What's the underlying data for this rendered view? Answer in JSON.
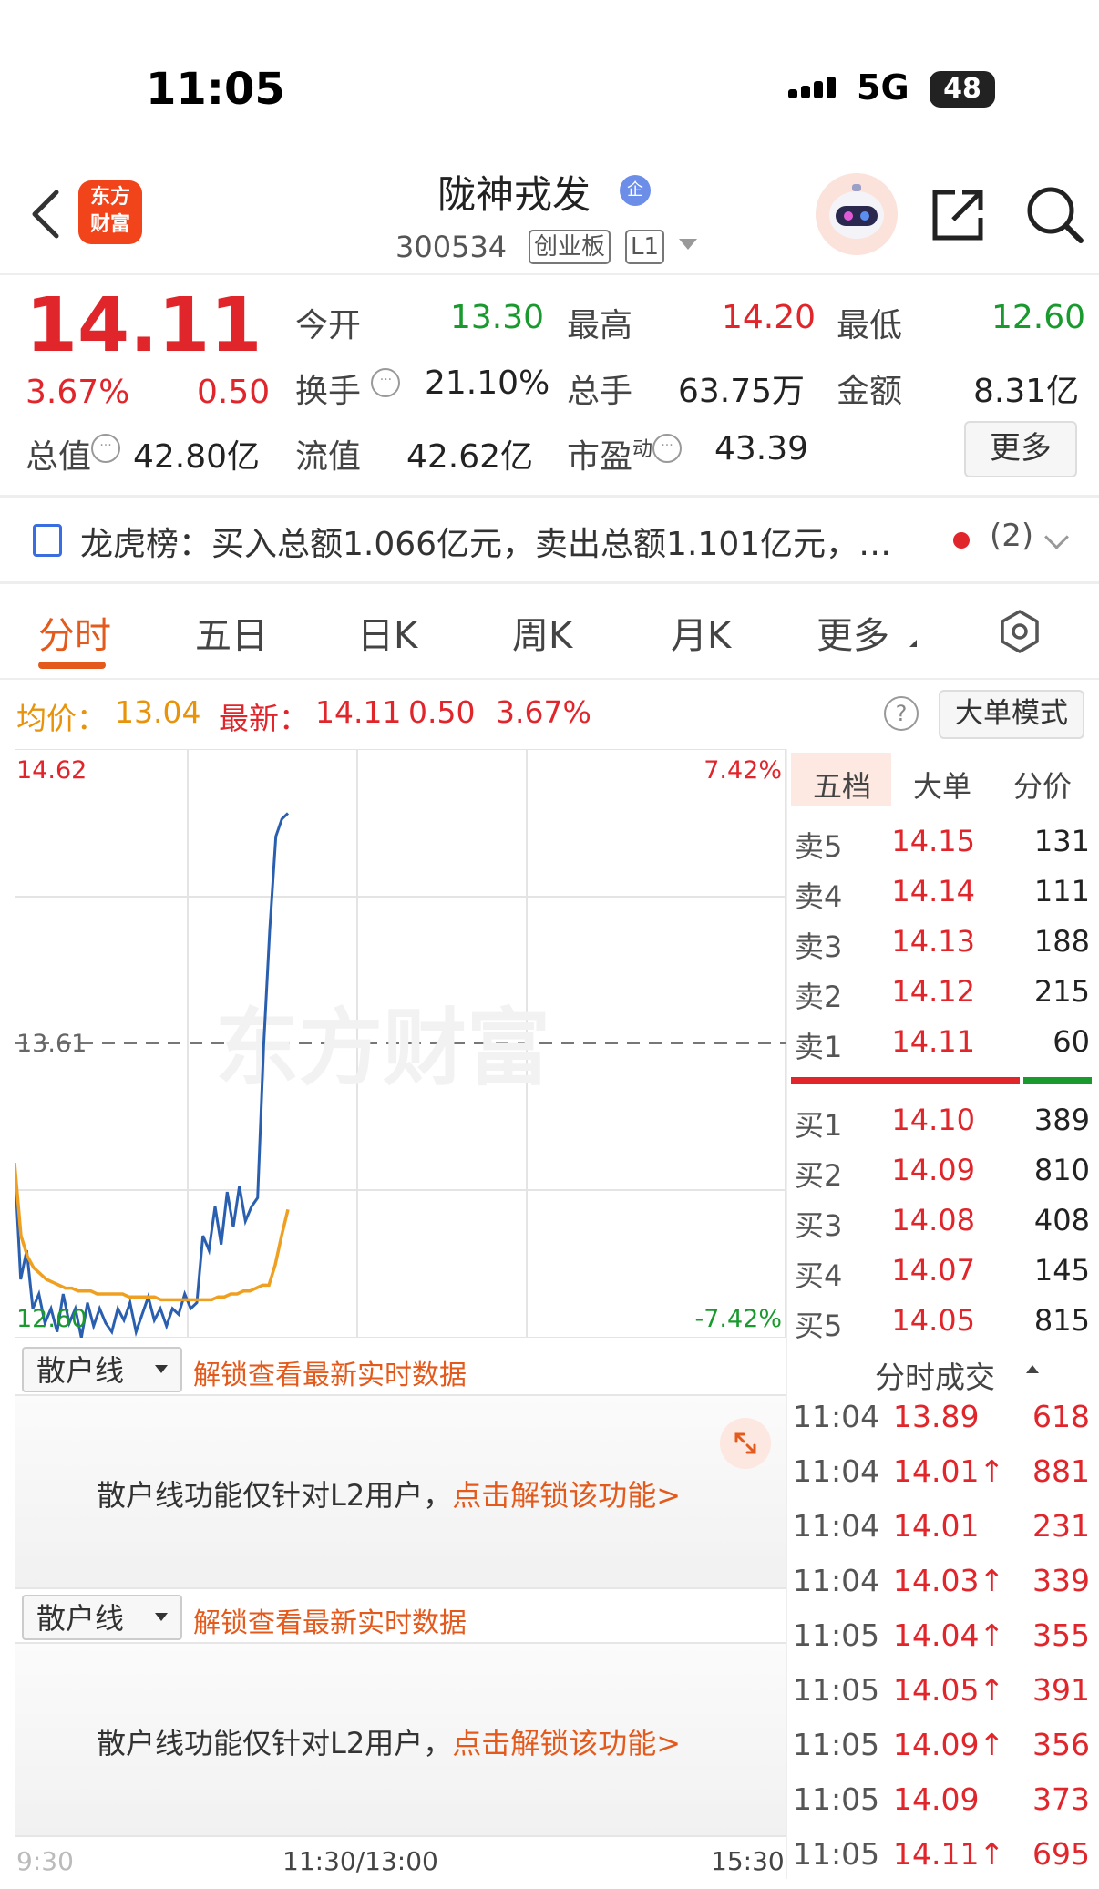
{
  "status_bar": {
    "time": "11:05",
    "network": "5G",
    "battery": "48"
  },
  "header": {
    "logo_line1": "东方",
    "logo_line2": "财富",
    "stock_name": "陇神戎发",
    "badge": "企",
    "code": "300534",
    "board": "创业板",
    "level": "L1"
  },
  "quote": {
    "price": "14.11",
    "change_pct": "3.67%",
    "change": "0.50",
    "open_label": "今开",
    "open": "13.30",
    "high_label": "最高",
    "high": "14.20",
    "low_label": "最低",
    "low": "12.60",
    "turnover_label": "换手",
    "turnover": "21.10%",
    "volume_label": "总手",
    "volume": "63.75万",
    "amount_label": "金额",
    "amount": "8.31亿",
    "mktcap_label": "总值",
    "mktcap": "42.80亿",
    "float_label": "流值",
    "float": "42.62亿",
    "pe_label": "市盈",
    "pe_sup": "动",
    "pe": "43.39",
    "more_button": "更多"
  },
  "dragon_tiger": {
    "text": "龙虎榜：买入总额1.066亿元，卖出总额1.101亿元，…",
    "count": "(2)"
  },
  "tabs": [
    "分时",
    "五日",
    "日K",
    "周K",
    "月K",
    "更多"
  ],
  "info_row": {
    "avg_label": "均价：",
    "avg": "13.04",
    "latest_label": "最新：",
    "latest": "14.11",
    "change": "0.50",
    "pct": "3.67%",
    "mode_button": "大单模式"
  },
  "chart_data": {
    "type": "line",
    "y_top": "14.62",
    "y_mid": "13.61",
    "y_bottom": "12.60",
    "pct_top": "7.42%",
    "pct_bottom": "-7.42%",
    "ylim": [
      12.6,
      14.62
    ],
    "x_labels": [
      "9:30",
      "11:30/13:00",
      "15:30"
    ],
    "watermark": "东方财富",
    "series": [
      {
        "color": "#2a5fb0",
        "values": [
          13.2,
          12.8,
          12.9,
          12.7,
          12.75,
          12.65,
          12.7,
          12.62,
          12.75,
          12.65,
          12.7,
          12.6,
          12.72,
          12.64,
          12.7,
          12.65,
          12.62,
          12.7,
          12.66,
          12.72,
          12.62,
          12.68,
          12.74,
          12.66,
          12.7,
          12.64,
          12.7,
          12.68,
          12.75,
          12.7,
          12.72,
          12.95,
          12.9,
          13.05,
          12.92,
          13.1,
          12.98,
          13.12,
          13.0,
          13.05,
          13.08,
          13.6,
          14.0,
          14.32,
          14.38,
          14.4
        ]
      },
      {
        "color": "#f0a020",
        "values": [
          13.2,
          12.95,
          12.88,
          12.84,
          12.82,
          12.8,
          12.79,
          12.78,
          12.77,
          12.77,
          12.76,
          12.76,
          12.76,
          12.75,
          12.75,
          12.75,
          12.75,
          12.75,
          12.74,
          12.74,
          12.74,
          12.74,
          12.74,
          12.73,
          12.73,
          12.73,
          12.73,
          12.73,
          12.73,
          12.73,
          12.73,
          12.73,
          12.74,
          12.74,
          12.75,
          12.75,
          12.76,
          12.76,
          12.77,
          12.78,
          12.78,
          12.85,
          12.95,
          13.04
        ]
      }
    ]
  },
  "order_book": {
    "tabs": [
      "五档",
      "大单",
      "分价"
    ],
    "asks": [
      {
        "label": "卖5",
        "price": "14.15",
        "vol": "131"
      },
      {
        "label": "卖4",
        "price": "14.14",
        "vol": "111"
      },
      {
        "label": "卖3",
        "price": "14.13",
        "vol": "188"
      },
      {
        "label": "卖2",
        "price": "14.12",
        "vol": "215"
      },
      {
        "label": "卖1",
        "price": "14.11",
        "vol": "60"
      }
    ],
    "bids": [
      {
        "label": "买1",
        "price": "14.10",
        "vol": "389"
      },
      {
        "label": "买2",
        "price": "14.09",
        "vol": "810"
      },
      {
        "label": "买3",
        "price": "14.08",
        "vol": "408"
      },
      {
        "label": "买4",
        "price": "14.07",
        "vol": "145"
      },
      {
        "label": "买5",
        "price": "14.05",
        "vol": "815"
      }
    ],
    "ratio_red": 0.76
  },
  "indicator_sections": [
    {
      "select": "散户线",
      "unlock": "解锁查看最新实时数据",
      "msg": "散户线功能仅针对L2用户，",
      "link": "点击解锁该功能>"
    },
    {
      "select": "散户线",
      "unlock": "解锁查看最新实时数据",
      "msg": "散户线功能仅针对L2用户，",
      "link": "点击解锁该功能>"
    }
  ],
  "trades": {
    "title": "分时成交",
    "rows": [
      {
        "time": "11:04",
        "price": "13.89",
        "vol": "618"
      },
      {
        "time": "11:04",
        "price": "14.01↑",
        "vol": "881"
      },
      {
        "time": "11:04",
        "price": "14.01",
        "vol": "231"
      },
      {
        "time": "11:04",
        "price": "14.03↑",
        "vol": "339"
      },
      {
        "time": "11:05",
        "price": "14.04↑",
        "vol": "355"
      },
      {
        "time": "11:05",
        "price": "14.05↑",
        "vol": "391"
      },
      {
        "time": "11:05",
        "price": "14.09↑",
        "vol": "356"
      },
      {
        "time": "11:05",
        "price": "14.09",
        "vol": "373"
      },
      {
        "time": "11:05",
        "price": "14.11↑",
        "vol": "695"
      }
    ]
  }
}
